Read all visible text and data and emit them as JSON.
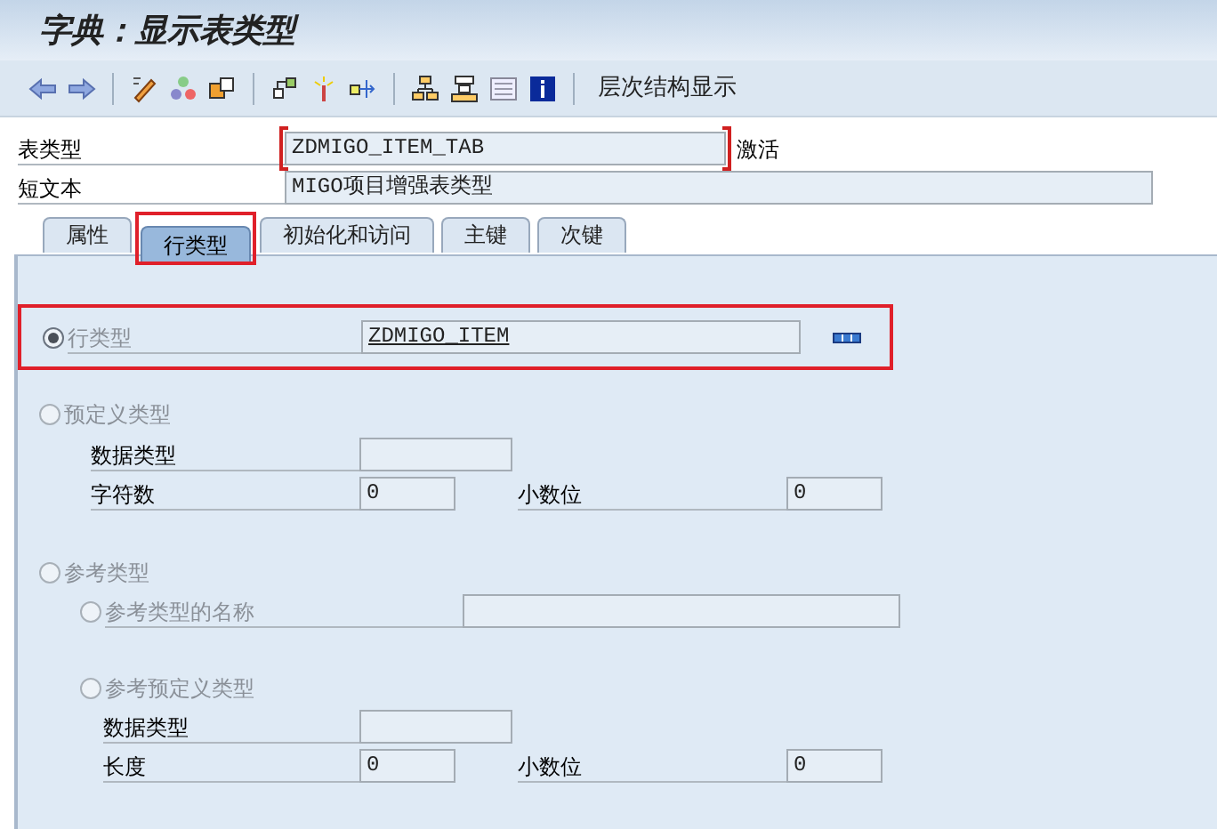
{
  "window": {
    "title": "字典：显示表类型"
  },
  "toolbar": {
    "text_button": "层次结构显示"
  },
  "header": [
    {
      "label": "表类型",
      "value": "ZDMIGO_ITEM_TAB",
      "required": true,
      "status": "激活"
    },
    {
      "label": "短文本",
      "value": "MIGO项目增强表类型",
      "required": false
    }
  ],
  "tabs": [
    {
      "label": "属性",
      "selected": false,
      "highlighted": false
    },
    {
      "label": "行类型",
      "selected": true,
      "highlighted": true
    },
    {
      "label": "初始化和访问",
      "selected": false,
      "highlighted": false
    },
    {
      "label": "主键",
      "selected": false,
      "highlighted": false
    },
    {
      "label": "次键",
      "selected": false,
      "highlighted": false
    }
  ],
  "row_type": {
    "label": "行类型",
    "selected": true,
    "value": "ZDMIGO_ITEM",
    "highlighted": true
  },
  "predefined_type": {
    "label": "预定义类型",
    "selected": false,
    "data_type": {
      "label": "数据类型"
    },
    "length": {
      "label": "字符数",
      "value": "0"
    },
    "decimals": {
      "label": "小数位",
      "value": "0"
    }
  },
  "reference_type": {
    "label": "参考类型",
    "selected": false,
    "options": [
      {
        "label": "参考类型的名称",
        "selected": false
      },
      {
        "label": "参考预定义类型",
        "selected": false
      }
    ],
    "data_type": {
      "label": "数据类型"
    },
    "length": {
      "label": "长度",
      "value": "0"
    },
    "decimals": {
      "label": "小数位",
      "value": "0"
    }
  }
}
